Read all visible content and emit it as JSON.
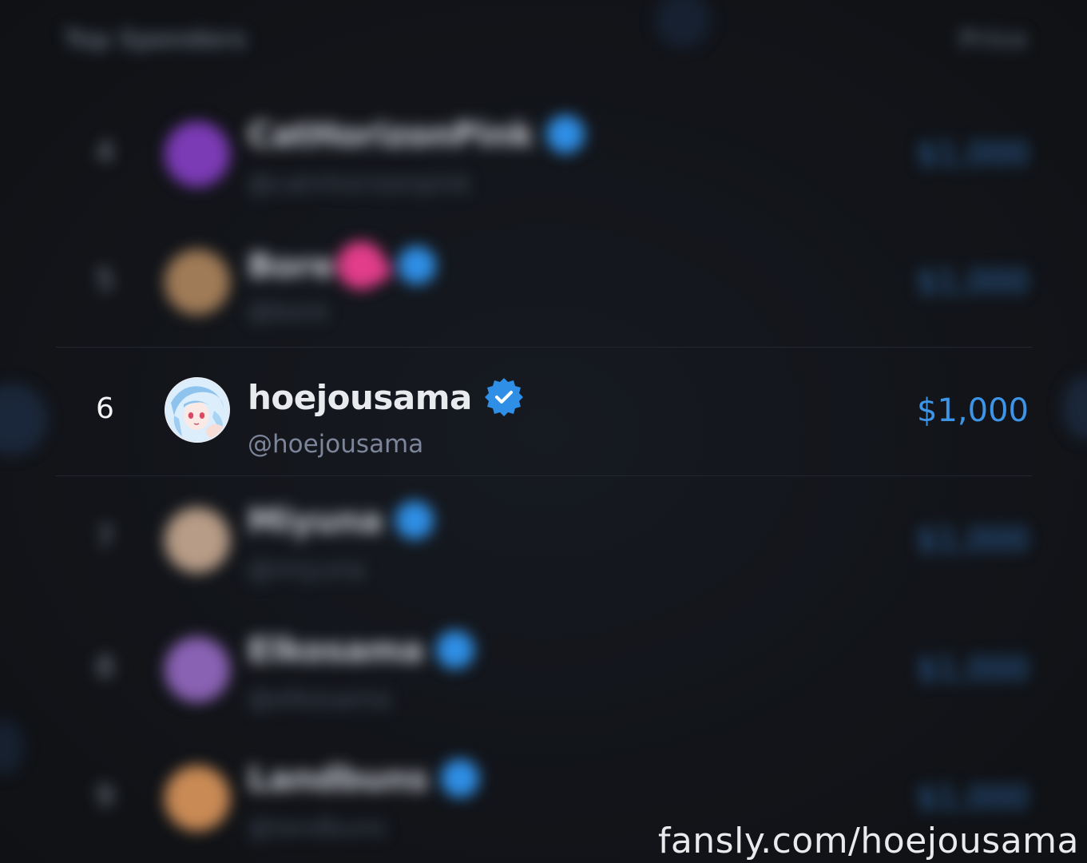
{
  "header": {
    "title": "Top Spenders",
    "right_label": "Price"
  },
  "rows": [
    {
      "rank": "4",
      "name": "CatHorizonPink",
      "handle": "@catnhorizonpink",
      "amount": "$1,000",
      "avatar_color": "#7b3bb5",
      "blurred": true
    },
    {
      "rank": "5",
      "name": "Bore",
      "handle": "@bore",
      "amount": "$1,000",
      "avatar_color": "#a07b57",
      "blurred": true
    },
    {
      "rank": "6",
      "name": "hoejousama",
      "handle": "@hoejousama",
      "amount": "$1,000",
      "avatar_color": "#a9d4f2",
      "blurred": false
    },
    {
      "rank": "7",
      "name": "Miyuna",
      "handle": "@miyuna",
      "amount": "$1,000",
      "avatar_color": "#b79c87",
      "blurred": true
    },
    {
      "rank": "8",
      "name": "Elkosama",
      "handle": "@elkosama",
      "amount": "$1,000",
      "avatar_color": "#8a62b4",
      "blurred": true
    },
    {
      "rank": "9",
      "name": "Landbuns",
      "handle": "@landbuns",
      "amount": "$1,000",
      "avatar_color": "#c98a55",
      "blurred": true
    }
  ],
  "watermark": "fansly.com/hoejousama",
  "colors": {
    "accent": "#3d95e8",
    "verified_badge": "#2f8fe6",
    "background": "#131519"
  },
  "icons": {
    "verified": "verified-check-icon",
    "lock": "lock-icon"
  }
}
